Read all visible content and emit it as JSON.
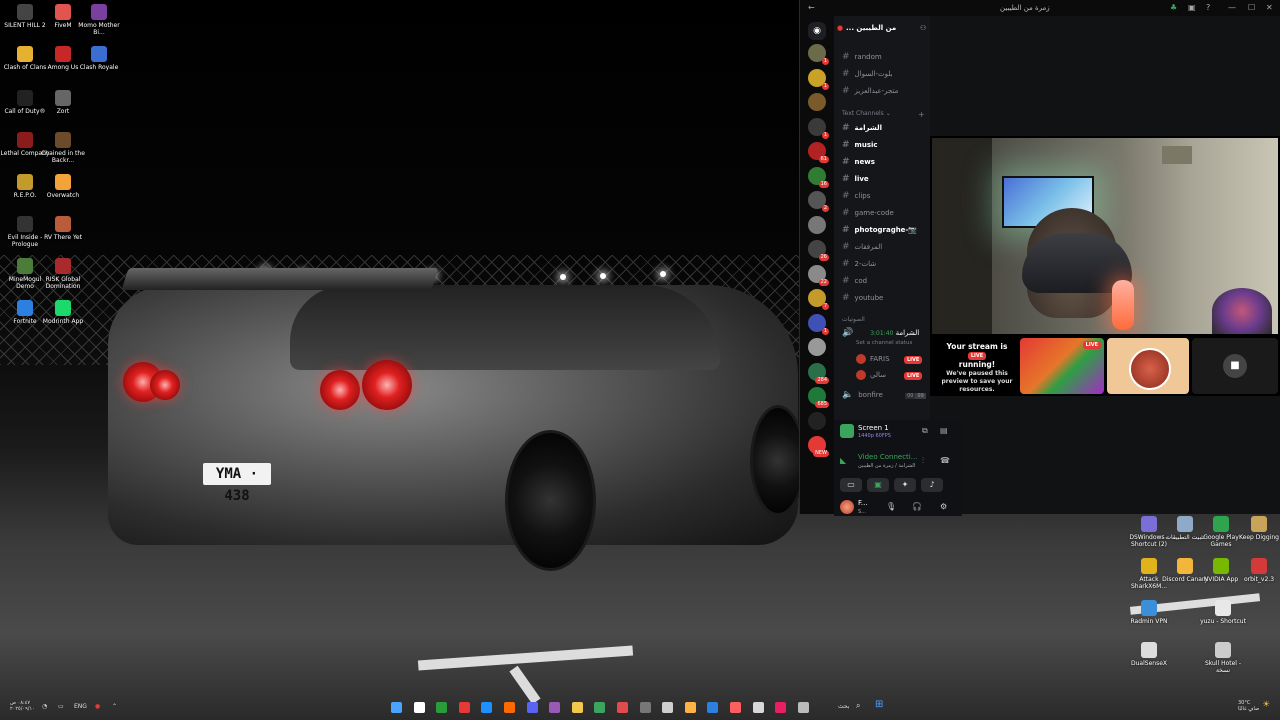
{
  "desktop_icons": [
    {
      "label": "SILENT HILL 2",
      "color": "#444444"
    },
    {
      "label": "FiveM",
      "color": "#e2554f"
    },
    {
      "label": "Momo Mother Bi...",
      "color": "#7a3fa0"
    },
    {
      "label": "Clash of Clans",
      "color": "#e6b031"
    },
    {
      "label": "Among Us",
      "color": "#c62828"
    },
    {
      "label": "Clash Royale",
      "color": "#3a6fd1"
    },
    {
      "label": "Call of Duty®",
      "color": "#222222"
    },
    {
      "label": "Zort",
      "color": "#666666"
    },
    {
      "label": "Lethal Company",
      "color": "#8a1c1c"
    },
    {
      "label": "Chained in the Backr...",
      "color": "#6b4b2a"
    },
    {
      "label": "R.E.P.O.",
      "color": "#c49a2b"
    },
    {
      "label": "Overwatch",
      "color": "#f2a33a"
    },
    {
      "label": "Evil Inside - Prologue",
      "color": "#333333"
    },
    {
      "label": "RV There Yet",
      "color": "#b85c3a"
    },
    {
      "label": "MineMogul Demo",
      "color": "#4b7d3a"
    },
    {
      "label": "RISK Global Domination",
      "color": "#a82a2a"
    },
    {
      "label": "Fortnite",
      "color": "#2d7fe0"
    },
    {
      "label": "Modrinth App",
      "color": "#1bd96a"
    }
  ],
  "right_icons": [
    {
      "label": "DSWindows - Shortcut (2)",
      "color": "#7a6fd6"
    },
    {
      "label": "تثبيت التطبيقات",
      "color": "#8fa9c8"
    },
    {
      "label": "Google Play Games",
      "color": "#2ea44f"
    },
    {
      "label": "Keep Digging",
      "color": "#c8a35a"
    },
    {
      "label": "Attack SharkX6M...",
      "color": "#e0b21c"
    },
    {
      "label": "Discord Canary",
      "color": "#f2b73a"
    },
    {
      "label": "NVIDIA App",
      "color": "#76b900"
    },
    {
      "label": "orbit_v2.3",
      "color": "#d43a3a"
    },
    {
      "label": "Radmin VPN",
      "color": "#3a8fd8"
    },
    {
      "label": "yuzu - Shortcut",
      "color": "#e8e8e8"
    },
    {
      "label": "DualSenseX",
      "color": "#dddddd"
    },
    {
      "label": "Skull Hotel - نسخة",
      "color": "#cccccc"
    }
  ],
  "wallpaper": {
    "plate": "YMA · 438"
  },
  "discord": {
    "title": "زمرة من الطيبين",
    "server_name": "... من الطيبين",
    "channels_top": [
      "random",
      "بلوت-السوال",
      "متجر-عبدالعزيز"
    ],
    "text_category": "Text Channels",
    "channels": [
      {
        "name": "الشرامة",
        "bold": true
      },
      {
        "name": "music",
        "bold": true
      },
      {
        "name": "news",
        "bold": true
      },
      {
        "name": "live",
        "bold": true
      },
      {
        "name": "clips",
        "bold": false
      },
      {
        "name": "game-code",
        "bold": false
      },
      {
        "name": "photograghe-📷",
        "bold": true
      },
      {
        "name": "المرفقات",
        "bold": false
      },
      {
        "name": "شات-2",
        "bold": false
      },
      {
        "name": "cod",
        "bold": false
      },
      {
        "name": "youtube",
        "bold": false
      }
    ],
    "voice_category": "الصوتيات",
    "voice_channel": {
      "name": "الشرامة",
      "time": "3:01:40",
      "status": "Set a channel status"
    },
    "voice_users": [
      {
        "name": "FARIS",
        "badge": "LIVE"
      },
      {
        "name": "سالي",
        "badge": "LIVE"
      }
    ],
    "bonfire": {
      "name": "bonfire",
      "count": "00",
      "limit": "99"
    },
    "server_badges": [
      "1",
      "1",
      "",
      "1",
      "61",
      "16",
      "2",
      "",
      "26",
      "22",
      "7",
      "1",
      "",
      "284",
      "685",
      "",
      "NEW"
    ],
    "screen_share": {
      "title": "Screen 1",
      "quality": "1440p 60FPS"
    },
    "connection": {
      "title": "Video Connecti...",
      "subtitle": "الشرامة / زمرة من الطيبين"
    },
    "user": {
      "name": "F...",
      "status": "S..."
    },
    "stage": {
      "paused_title": "Your stream is",
      "paused_live": "LIVE",
      "paused_title2": "running!",
      "paused_msg": "We've paused this preview to save your resources.",
      "tile_badge": "LIVE"
    }
  },
  "taskbar": {
    "search": "بحث",
    "lang": "ENG",
    "time": "٠٨:٤٧ ص",
    "date": "٢٠٢٥/٠٩/١٠",
    "weather_temp": "30°C",
    "weather_desc": "صافٍ غالبًا"
  }
}
